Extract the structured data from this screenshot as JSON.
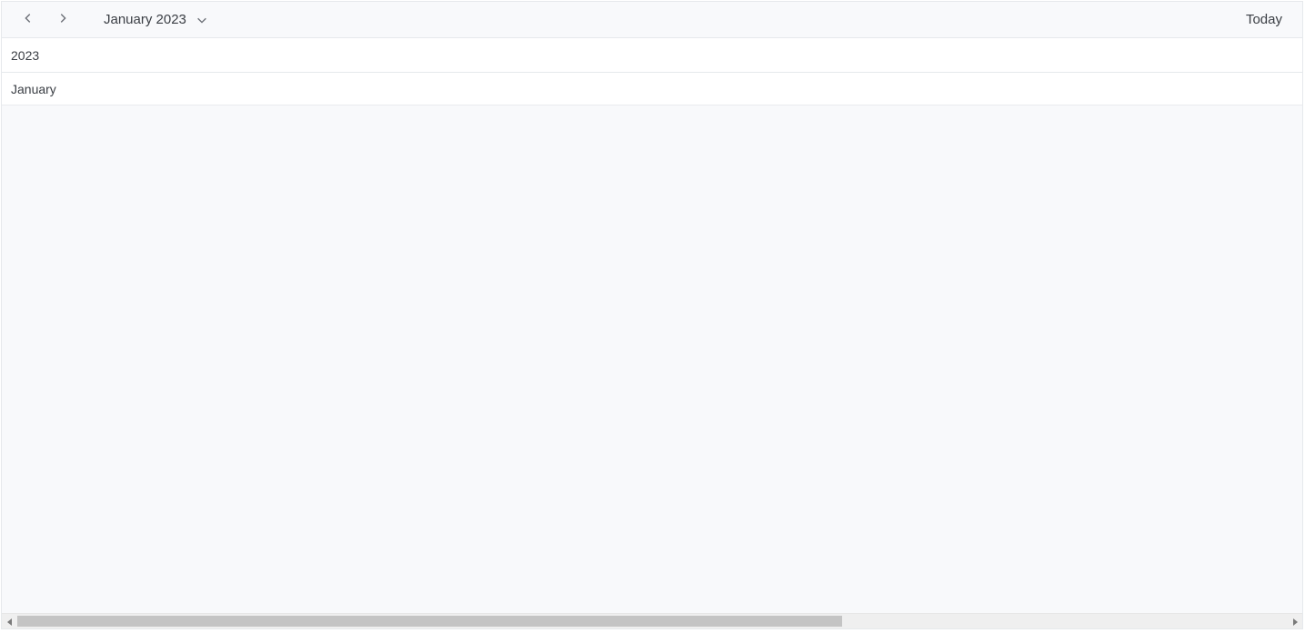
{
  "toolbar": {
    "current_period_label": "January 2023",
    "today_label": "Today"
  },
  "timeline": {
    "year_label": "2023",
    "month_label": "January"
  }
}
